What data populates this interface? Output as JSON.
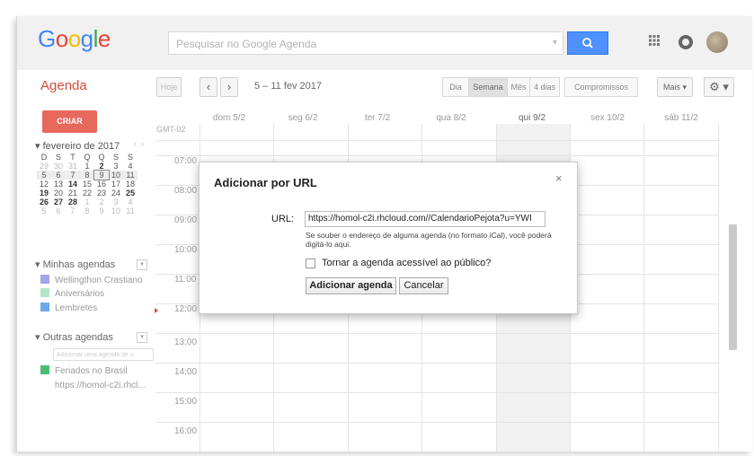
{
  "header": {
    "logo": "Google",
    "search_placeholder": "Pesquisar no Google Agenda"
  },
  "toolbar": {
    "app_title": "Agenda",
    "today_label": "Hoje",
    "prev_label": "‹",
    "next_label": "›",
    "date_range": "5 – 11 fev 2017",
    "views": [
      "Dia",
      "Semana",
      "Mês",
      "4 dias",
      "Compromissos"
    ],
    "selected_view": "Semana",
    "more_label": "Mais ▾",
    "settings_icon": "gear-icon"
  },
  "sidebar": {
    "create_label": "CRIAR",
    "month_title": "fevereiro de 2017",
    "mini_calendar": {
      "weekdays": [
        "D",
        "S",
        "T",
        "Q",
        "Q",
        "S",
        "S"
      ],
      "weeks": [
        [
          "29",
          "30",
          "31",
          "1",
          "2",
          "3",
          "4"
        ],
        [
          "5",
          "6",
          "7",
          "8",
          "9",
          "10",
          "11"
        ],
        [
          "12",
          "13",
          "14",
          "15",
          "16",
          "17",
          "18"
        ],
        [
          "19",
          "20",
          "21",
          "22",
          "23",
          "24",
          "25"
        ],
        [
          "26",
          "27",
          "28",
          "1",
          "2",
          "3",
          "4"
        ],
        [
          "5",
          "6",
          "7",
          "8",
          "9",
          "10",
          "11"
        ]
      ]
    },
    "my_calendars_title": "Minhas agendas",
    "my_calendars": [
      {
        "name": "Wellingthon Crastiano",
        "color": "#a7a3e8"
      },
      {
        "name": "Aniversários",
        "color": "#b3e6c7"
      },
      {
        "name": "Lembretes",
        "color": "#6fa8e8"
      }
    ],
    "other_calendars_title": "Outras agendas",
    "add_calendar_placeholder": "Adicionar uma agenda de u",
    "other_calendars": [
      {
        "name": "Feriados no Brasil",
        "color": "#4ebd74"
      },
      {
        "name": "https://homol-c2i.rhcl...",
        "color": "#ffffff"
      }
    ]
  },
  "grid": {
    "timezone": "GMT-02",
    "days": [
      "dom 5/2",
      "seg 6/2",
      "ter 7/2",
      "qua 8/2",
      "qui 9/2",
      "sex 10/2",
      "sáb 11/2"
    ],
    "times": [
      "07:00",
      "08:00",
      "09:00",
      "10:00",
      "11:00",
      "12:00",
      "13:00",
      "14:00",
      "15:00",
      "16:00"
    ]
  },
  "dialog": {
    "title": "Adicionar por URL",
    "close_label": "×",
    "url_label": "URL:",
    "url_value": "https://homol-c2i.rhcloud.com//CalendarioPejota?u=YWI",
    "hint": "Se souber o endereço de alguma agenda (no formato iCal), você poderá digitá-lo aqui.",
    "public_checkbox_label": "Tornar a agenda acessível ao público?",
    "add_button": "Adicionar agenda",
    "cancel_button": "Cancelar"
  }
}
